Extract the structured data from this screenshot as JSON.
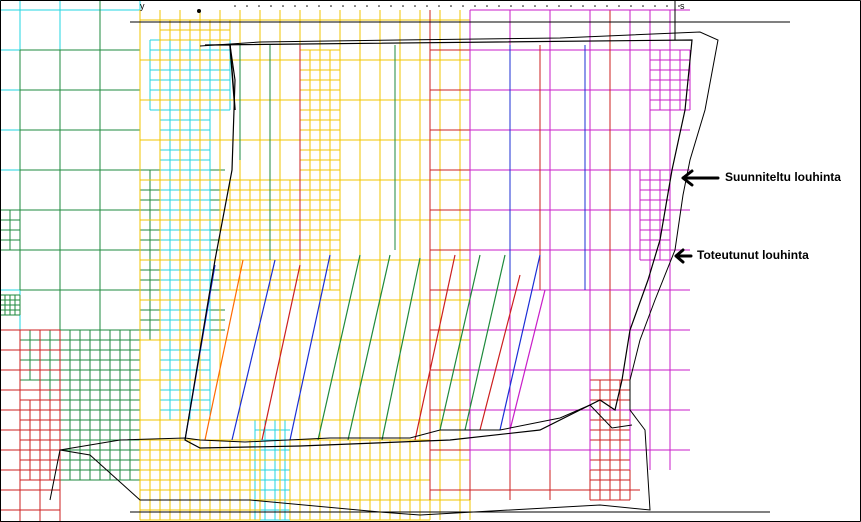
{
  "annotations": {
    "planned": "Suunniteltu louhinta",
    "actual": "Toteutunut louhinta"
  },
  "top_marks": [
    "y",
    "s"
  ],
  "colors": {
    "cyan": "#22d6e0",
    "green": "#1e8a3c",
    "red": "#cc1f1f",
    "yellow": "#f2c400",
    "magenta": "#c81ec8",
    "blue": "#1b2fd6",
    "orange": "#ff6a00",
    "black": "#000000"
  }
}
